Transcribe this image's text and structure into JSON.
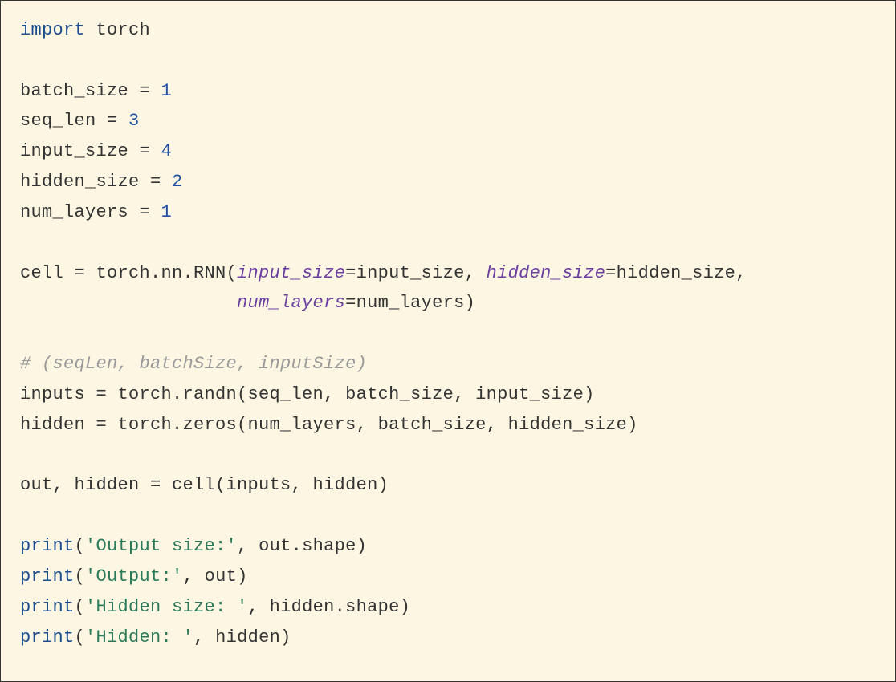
{
  "code": {
    "line1": {
      "kw_import": "import",
      "module": " torch"
    },
    "line2": "",
    "line3": {
      "var": "batch_size = ",
      "num": "1"
    },
    "line4": {
      "var": "seq_len = ",
      "num": "3"
    },
    "line5": {
      "var": "input_size = ",
      "num": "4"
    },
    "line6": {
      "var": "hidden_size = ",
      "num": "2"
    },
    "line7": {
      "var": "num_layers = ",
      "num": "1"
    },
    "line8": "",
    "line9": {
      "pre": "cell = torch.nn.RNN(",
      "kw1": "input_size",
      "eq1": "=input_size, ",
      "kw2": "hidden_size",
      "eq2": "=hidden_size,"
    },
    "line10": {
      "indent": "                    ",
      "kw3": "num_layers",
      "eq3": "=num_layers)"
    },
    "line11": "",
    "line12": {
      "comment": "# (seqLen, batchSize, inputSize)"
    },
    "line13": {
      "text": "inputs = torch.randn(seq_len, batch_size, input_size)"
    },
    "line14": {
      "text": "hidden = torch.zeros(num_layers, batch_size, hidden_size)"
    },
    "line15": "",
    "line16": {
      "text": "out, hidden = cell(inputs, hidden)"
    },
    "line17": "",
    "line18": {
      "fn": "print",
      "p1": "(",
      "str": "'Output size:'",
      "rest": ", out.shape)"
    },
    "line19": {
      "fn": "print",
      "p1": "(",
      "str": "'Output:'",
      "rest": ", out)"
    },
    "line20": {
      "fn": "print",
      "p1": "(",
      "str": "'Hidden size: '",
      "rest": ", hidden.shape)"
    },
    "line21": {
      "fn": "print",
      "p1": "(",
      "str": "'Hidden: '",
      "rest": ", hidden)"
    }
  }
}
